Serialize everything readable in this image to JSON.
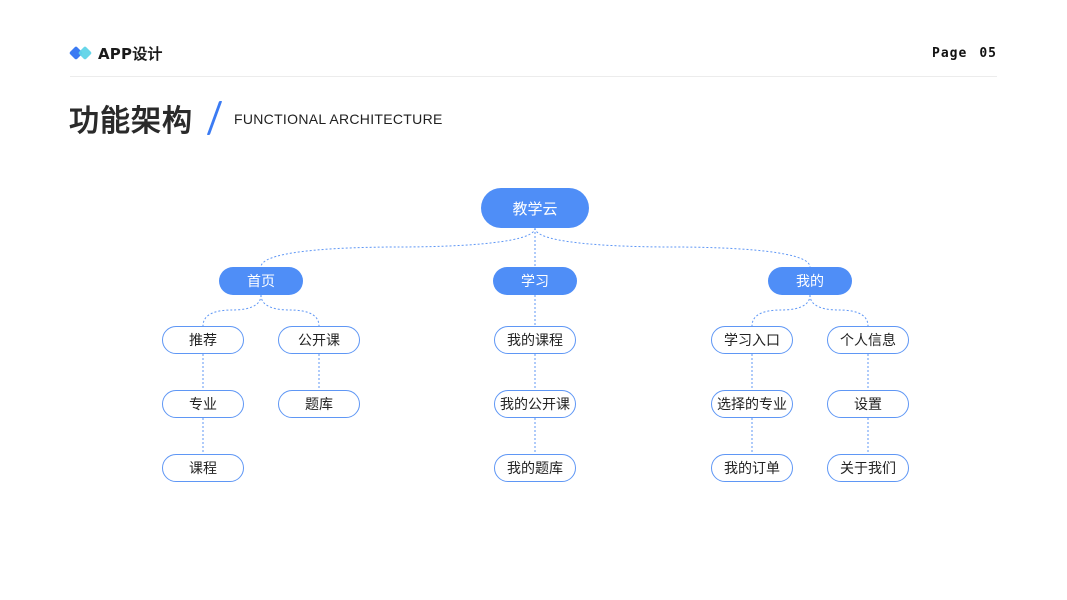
{
  "header": {
    "app_title": "APP设计",
    "page_label": "Page",
    "page_number": "05"
  },
  "title": {
    "cn": "功能架构",
    "en": "FUNCTIONAL ARCHITECTURE"
  },
  "colors": {
    "accent": "#3b7bf3",
    "node_fill": "#4f8ef7",
    "node_border": "#5f97f5",
    "logo_secondary": "#5fd4e8"
  },
  "tree": {
    "root": "教学云",
    "branches": [
      {
        "label": "首页",
        "columns": [
          [
            "推荐",
            "专业",
            "课程"
          ],
          [
            "公开课",
            "题库"
          ]
        ]
      },
      {
        "label": "学习",
        "columns": [
          [
            "我的课程",
            "我的公开课",
            "我的题库"
          ]
        ]
      },
      {
        "label": "我的",
        "columns": [
          [
            "学习入口",
            "选择的专业",
            "我的订单"
          ],
          [
            "个人信息",
            "设置",
            "关于我们"
          ]
        ]
      }
    ]
  }
}
